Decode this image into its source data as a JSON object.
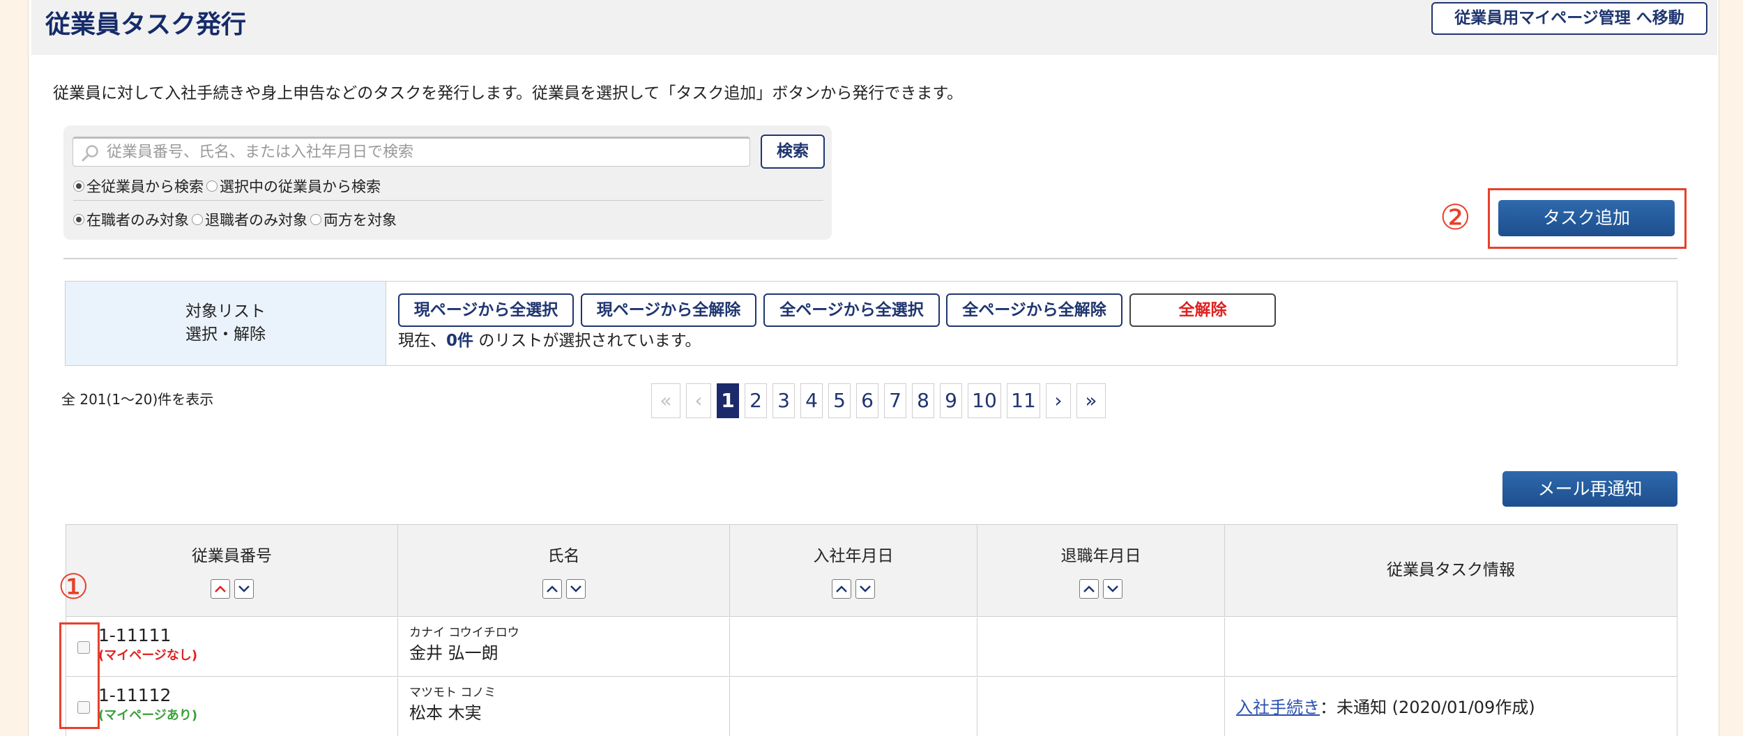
{
  "header": {
    "title": "従業員タスク発行",
    "mypage_button": "従業員用マイページ管理 へ移動"
  },
  "description": "従業員に対して入社手続きや身上申告などのタスクを発行します。従業員を選択して「タスク追加」ボタンから発行できます。",
  "search": {
    "placeholder": "従業員番号、氏名、または入社年月日で検索",
    "button": "検索",
    "scope_options": [
      {
        "label": "全従業員から検索",
        "selected": true
      },
      {
        "label": "選択中の従業員から検索",
        "selected": false
      }
    ],
    "status_options": [
      {
        "label": "在職者のみ対象",
        "selected": true
      },
      {
        "label": "退職者のみ対象",
        "selected": false
      },
      {
        "label": "両方を対象",
        "selected": false
      }
    ]
  },
  "annotations": {
    "circle_1": "①",
    "circle_2": "②"
  },
  "task_add_button": "タスク追加",
  "target_list": {
    "label_line1": "対象リスト",
    "label_line2": "選択・解除",
    "buttons": [
      "現ページから全選択",
      "現ページから全解除",
      "全ページから全選択",
      "全ページから全解除",
      "全解除"
    ],
    "status_prefix": "現在、",
    "status_count": "0件",
    "status_suffix": " のリストが選択されています。"
  },
  "pagination": {
    "total_text": "全 201(1〜20)件を表示",
    "first": "«",
    "prev": "‹",
    "pages": [
      "1",
      "2",
      "3",
      "4",
      "5",
      "6",
      "7",
      "8",
      "9",
      "10",
      "11"
    ],
    "current": "1",
    "next": "›",
    "last": "»"
  },
  "resend_button": "メール再通知",
  "table": {
    "columns": [
      "従業員番号",
      "氏名",
      "入社年月日",
      "退職年月日",
      "従業員タスク情報"
    ],
    "rows": [
      {
        "emp_no": "1-11111",
        "mypage": "(マイページなし)",
        "mypage_status": "none",
        "name_kana": "カナイ コウイチロウ",
        "name": "金井 弘一朗",
        "hire_date": "",
        "retire_date": "",
        "task_link": "",
        "task_text": ""
      },
      {
        "emp_no": "1-11112",
        "mypage": "(マイページあり)",
        "mypage_status": "has",
        "name_kana": "マツモト コノミ",
        "name": "松本 木実",
        "hire_date": "",
        "retire_date": "",
        "task_link": "入社手続き",
        "task_text": "：未通知 (2020/01/09作成)"
      }
    ]
  },
  "colors": {
    "navy": "#1f3570",
    "accent_red": "#e8402a",
    "blue_button": "#2560a3",
    "highlight_bg": "#eaf3fb"
  },
  "icons": {
    "search": "magnifier-icon",
    "sort_up": "chevron-up-icon",
    "sort_down": "chevron-down-icon"
  }
}
